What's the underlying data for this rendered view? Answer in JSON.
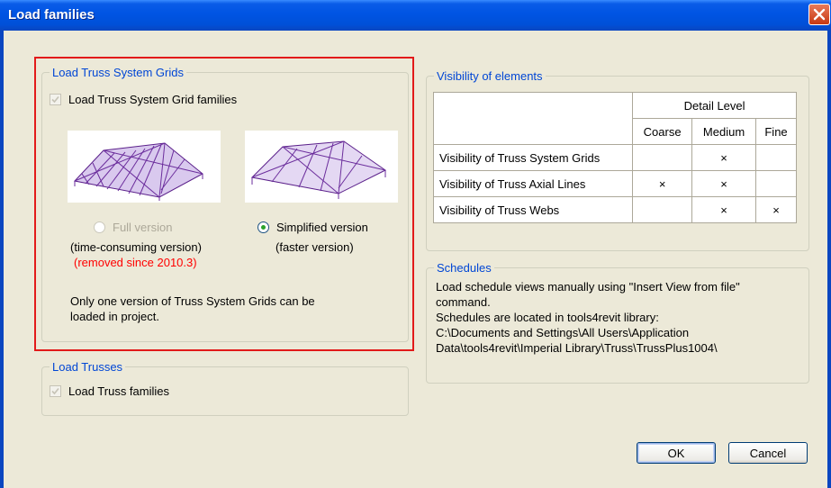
{
  "window": {
    "title": "Load families"
  },
  "colors": {
    "title_bar": "#0054e3",
    "group_legend": "#0046d5",
    "highlight_border": "#e21a1a",
    "removed_text": "#ff0000"
  },
  "truss_grids": {
    "legend": "Load Truss System Grids",
    "load_checkbox_label": "Load Truss System Grid families",
    "full_version": {
      "label": "Full version",
      "note": "(time-consuming version)",
      "removed": "(removed since 2010.3)",
      "selected": false
    },
    "simplified_version": {
      "label": "Simplified version",
      "note": "(faster version)",
      "selected": true
    },
    "info": [
      "Only one version of Truss System Grids can be",
      "loaded in project."
    ]
  },
  "trusses": {
    "legend": "Load Trusses",
    "load_checkbox_label": "Load Truss families"
  },
  "visibility": {
    "legend": "Visibility of elements",
    "detail_level": "Detail Level",
    "columns": [
      "Coarse",
      "Medium",
      "Fine"
    ],
    "rows": [
      {
        "label": "Visibility of Truss System Grids",
        "coarse": "",
        "medium": "×",
        "fine": ""
      },
      {
        "label": "Visibility of Truss Axial Lines",
        "coarse": "×",
        "medium": "×",
        "fine": ""
      },
      {
        "label": "Visibility of Truss Webs",
        "coarse": "",
        "medium": "×",
        "fine": "×"
      }
    ]
  },
  "schedules": {
    "legend": "Schedules",
    "lines": [
      "Load schedule views manually using \"Insert View from file\"",
      "command.",
      "Schedules are located in tools4revit library:",
      "C:\\Documents and Settings\\All Users\\Application",
      "Data\\tools4revit\\Imperial Library\\Truss\\TrussPlus1004\\"
    ]
  },
  "buttons": {
    "ok": "OK",
    "cancel": "Cancel"
  }
}
